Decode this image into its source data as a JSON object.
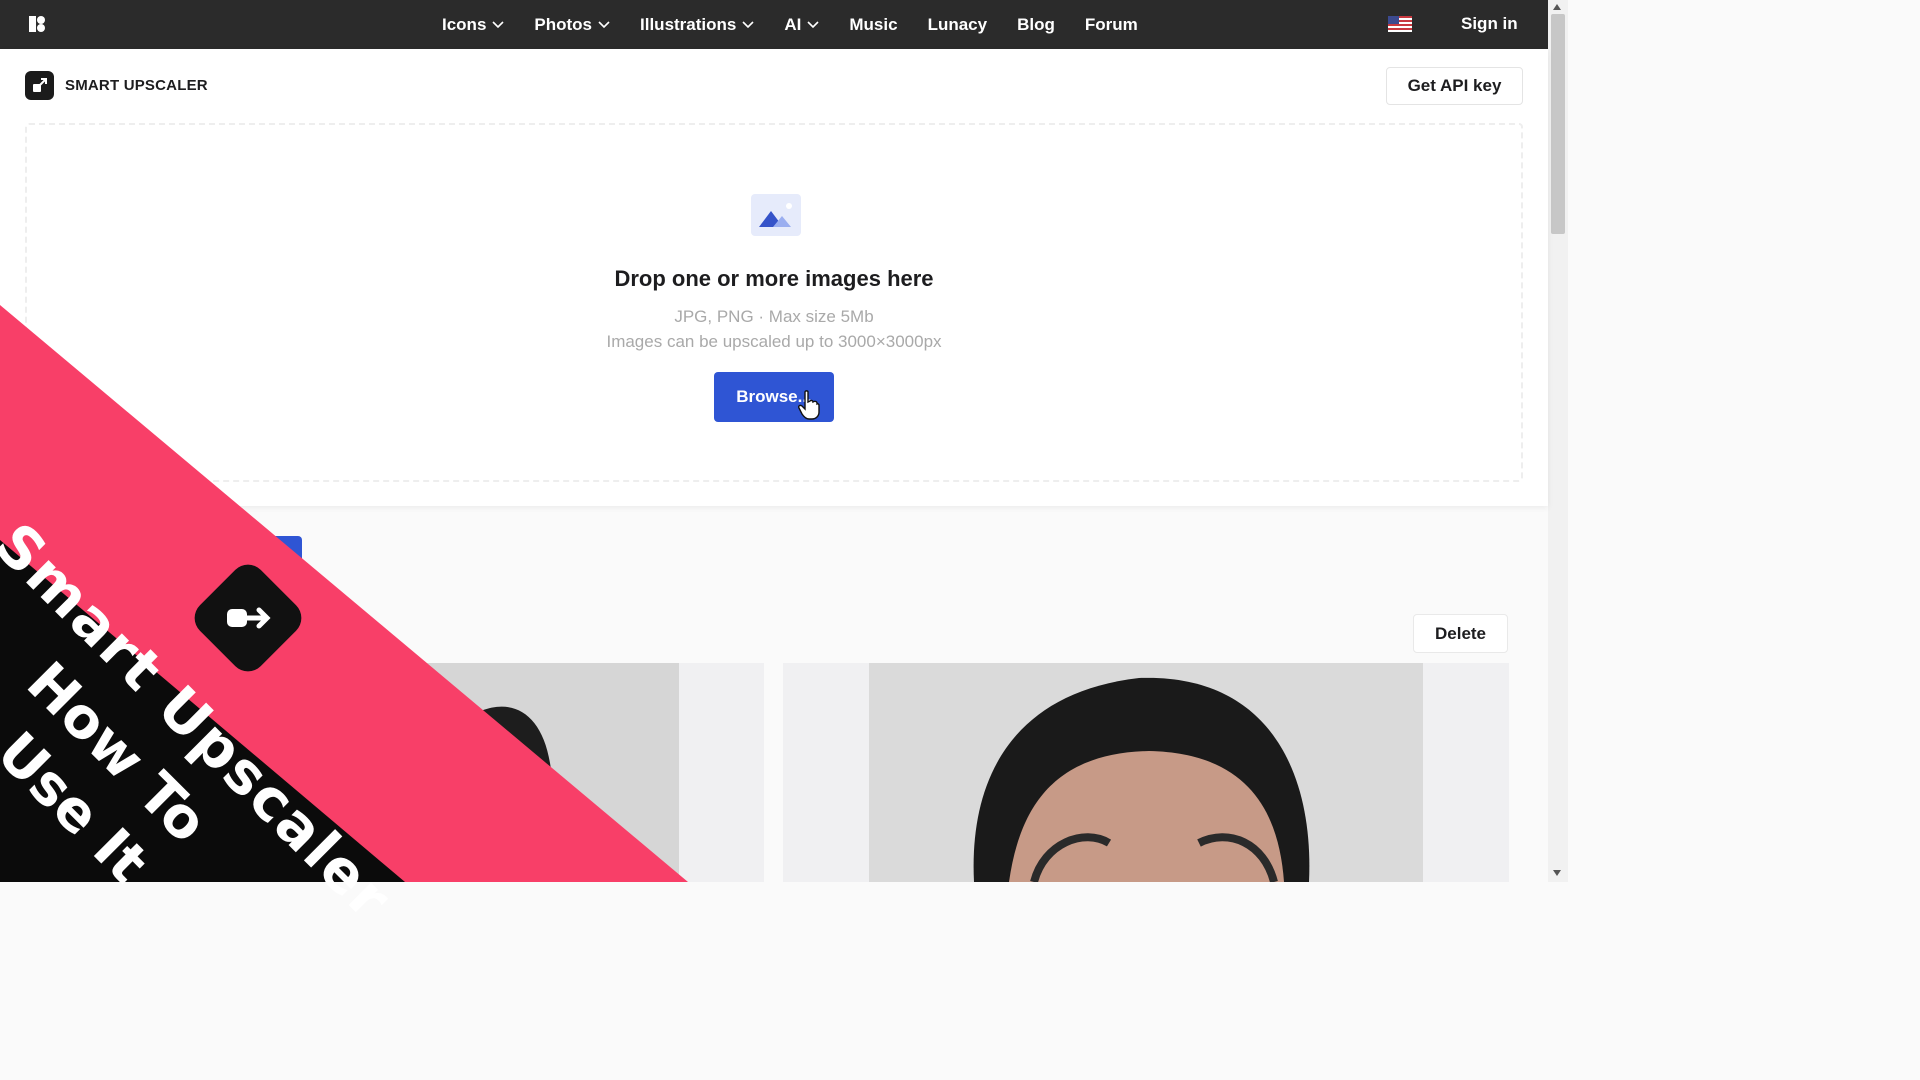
{
  "nav": {
    "items": [
      {
        "label": "Icons",
        "dropdown": true
      },
      {
        "label": "Photos",
        "dropdown": true
      },
      {
        "label": "Illustrations",
        "dropdown": true
      },
      {
        "label": "AI",
        "dropdown": true
      },
      {
        "label": "Music",
        "dropdown": false
      },
      {
        "label": "Lunacy",
        "dropdown": false
      },
      {
        "label": "Blog",
        "dropdown": false
      },
      {
        "label": "Forum",
        "dropdown": false
      }
    ],
    "sign_in": "Sign in",
    "colors": {
      "bar": "#2b2b2b",
      "text": "#ffffff"
    }
  },
  "header": {
    "app_title": "SMART UPSCALER",
    "api_button": "Get API key"
  },
  "dropzone": {
    "title": "Drop one or more images here",
    "formats": "JPG, PNG · Max size 5Mb",
    "limit": "Images can be upscaled up to 3000×3000px",
    "browse_label": "Browse...",
    "accent": "#2f55d4"
  },
  "results": {
    "delete_label": "Delete"
  },
  "overlay": {
    "title": "Smart Upscaler",
    "line1": "How To",
    "line2": "Use It",
    "colors": {
      "band": "#f83f68",
      "corner": "#0b0b0b"
    }
  }
}
